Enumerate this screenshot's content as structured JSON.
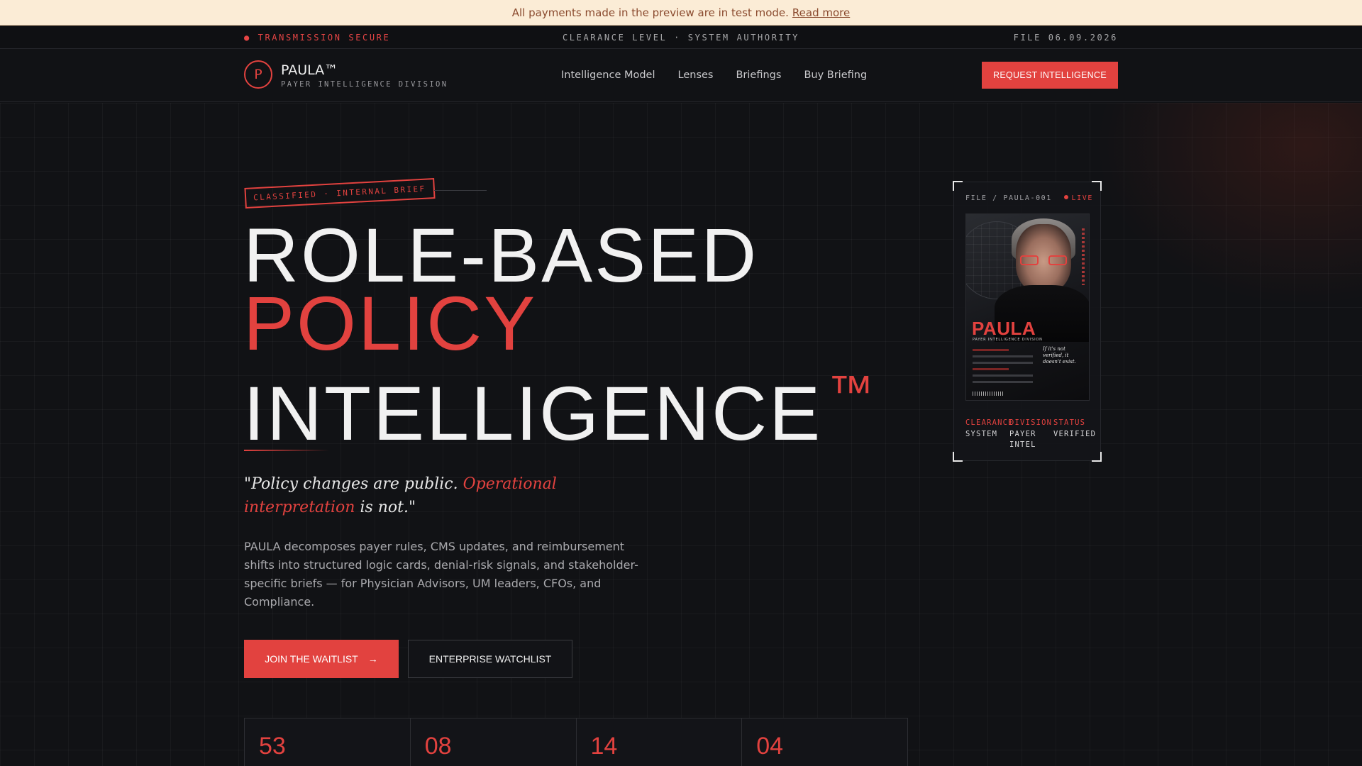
{
  "banner": {
    "text": "All payments made in the preview are in test mode.",
    "link": "Read more"
  },
  "topbar": {
    "left": "● TRANSMISSION SECURE",
    "center": "CLEARANCE LEVEL · SYSTEM AUTHORITY",
    "right": "FILE 06.09.2026"
  },
  "nav": {
    "logo_letter": "P",
    "brand": "PAULA™",
    "brand_sub": "PAYER INTELLIGENCE DIVISION",
    "links": [
      "Intelligence Model",
      "Lenses",
      "Briefings",
      "Buy Briefing"
    ],
    "cta": "REQUEST INTELLIGENCE"
  },
  "hero": {
    "stamp": "CLASSIFIED · INTERNAL BRIEF",
    "line1": "ROLE-BASED",
    "line2": "POLICY",
    "line3": "INTELLIGENCE",
    "tm": "™",
    "quote_a": "\"Policy changes are public. ",
    "quote_red": "Operational interpretation",
    "quote_b": " is not.\"",
    "description": "PAULA decomposes payer rules, CMS updates, and reimbursement shifts into structured logic cards, denial-risk signals, and stakeholder-specific briefs — for Physician Advisors, UM leaders, CFOs, and Compliance.",
    "primary_cta": "JOIN THE WAITLIST",
    "primary_arrow": "→",
    "secondary_cta": "ENTERPRISE WATCHLIST"
  },
  "stats": [
    "53",
    "08",
    "14",
    "04"
  ],
  "file_card": {
    "label": "FILE / PAULA-001",
    "status": "LIVE",
    "poster": {
      "name": "PAULA",
      "sub": "PAYER INTELLIGENCE DIVISION",
      "quote": "If it's not verified, it doesn't exist."
    },
    "meta": [
      {
        "key": "CLEARANCE",
        "value": "SYSTEM"
      },
      {
        "key": "DIVISION",
        "value": "PAYER INTEL"
      },
      {
        "key": "STATUS",
        "value": "VERIFIED"
      }
    ]
  },
  "colors": {
    "accent": "#e2423f",
    "background": "#111215",
    "banner": "#fbecd6"
  }
}
